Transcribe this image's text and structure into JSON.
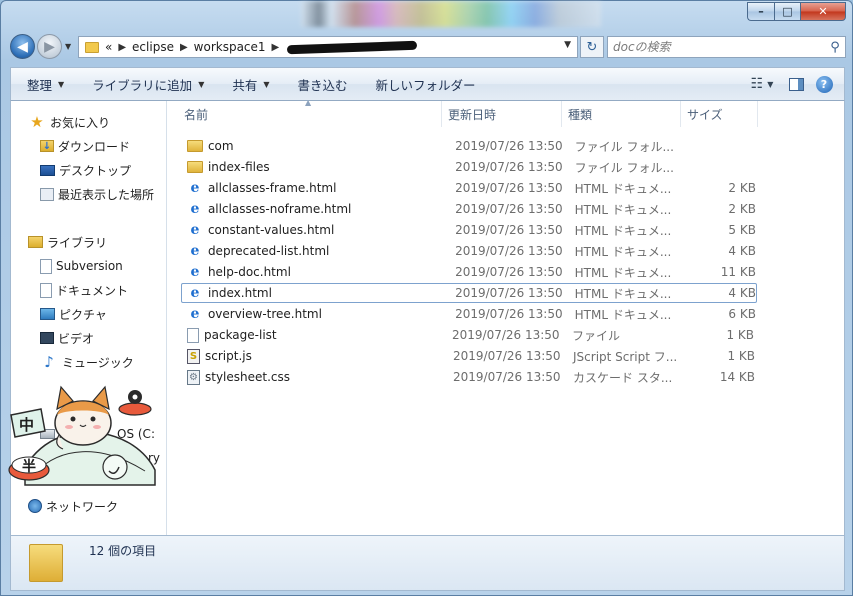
{
  "window": {
    "caption": {
      "minimize": "–",
      "maximize": "□",
      "close": "✕"
    }
  },
  "address": {
    "back": "◀",
    "forward": "▶",
    "crumbs": [
      "«",
      "eclipse",
      "workspace1"
    ],
    "search_placeholder": "docの検索",
    "refresh": "↻"
  },
  "commands": {
    "organize": "整理",
    "add_to_library": "ライブラリに追加",
    "share": "共有",
    "burn": "書き込む",
    "new_folder": "新しいフォルダー",
    "help": "?"
  },
  "nav": {
    "favorites": {
      "label": "お気に入り",
      "items": [
        "ダウンロード",
        "デスクトップ",
        "最近表示した場所"
      ]
    },
    "libraries": {
      "label": "ライブラリ",
      "items": [
        "Subversion",
        "ドキュメント",
        "ピクチャ",
        "ビデオ",
        "ミュージック"
      ]
    },
    "computer_fragments": [
      "OS (C:",
      "ry"
    ],
    "network": "ネットワーク"
  },
  "columns": {
    "name": "名前",
    "date": "更新日時",
    "type": "種類",
    "size": "サイズ"
  },
  "files": [
    {
      "name": "com",
      "date": "2019/07/26 13:50",
      "type": "ファイル フォル...",
      "size": "",
      "icon": "folder-icon"
    },
    {
      "name": "index-files",
      "date": "2019/07/26 13:50",
      "type": "ファイル フォル...",
      "size": "",
      "icon": "folder-icon"
    },
    {
      "name": "allclasses-frame.html",
      "date": "2019/07/26 13:50",
      "type": "HTML ドキュメ...",
      "size": "2 KB",
      "icon": "html-icon"
    },
    {
      "name": "allclasses-noframe.html",
      "date": "2019/07/26 13:50",
      "type": "HTML ドキュメ...",
      "size": "2 KB",
      "icon": "html-icon"
    },
    {
      "name": "constant-values.html",
      "date": "2019/07/26 13:50",
      "type": "HTML ドキュメ...",
      "size": "5 KB",
      "icon": "html-icon"
    },
    {
      "name": "deprecated-list.html",
      "date": "2019/07/26 13:50",
      "type": "HTML ドキュメ...",
      "size": "4 KB",
      "icon": "html-icon"
    },
    {
      "name": "help-doc.html",
      "date": "2019/07/26 13:50",
      "type": "HTML ドキュメ...",
      "size": "11 KB",
      "icon": "html-icon"
    },
    {
      "name": "index.html",
      "date": "2019/07/26 13:50",
      "type": "HTML ドキュメ...",
      "size": "4 KB",
      "icon": "html-icon",
      "selected": true
    },
    {
      "name": "overview-tree.html",
      "date": "2019/07/26 13:50",
      "type": "HTML ドキュメ...",
      "size": "6 KB",
      "icon": "html-icon"
    },
    {
      "name": "package-list",
      "date": "2019/07/26 13:50",
      "type": "ファイル",
      "size": "1 KB",
      "icon": "file-icon"
    },
    {
      "name": "script.js",
      "date": "2019/07/26 13:50",
      "type": "JScript Script フ...",
      "size": "1 KB",
      "icon": "js-icon"
    },
    {
      "name": "stylesheet.css",
      "date": "2019/07/26 13:50",
      "type": "カスケード スタ...",
      "size": "14 KB",
      "icon": "css-icon"
    }
  ],
  "status": {
    "item_count": "12 個の項目"
  },
  "overlay": {
    "kanji_1": "中",
    "kanji_2": "半"
  },
  "colors": {
    "selection_border": "#7da2ce",
    "window_glass": "#b8d2ea",
    "accent": "#1f6fd0"
  }
}
